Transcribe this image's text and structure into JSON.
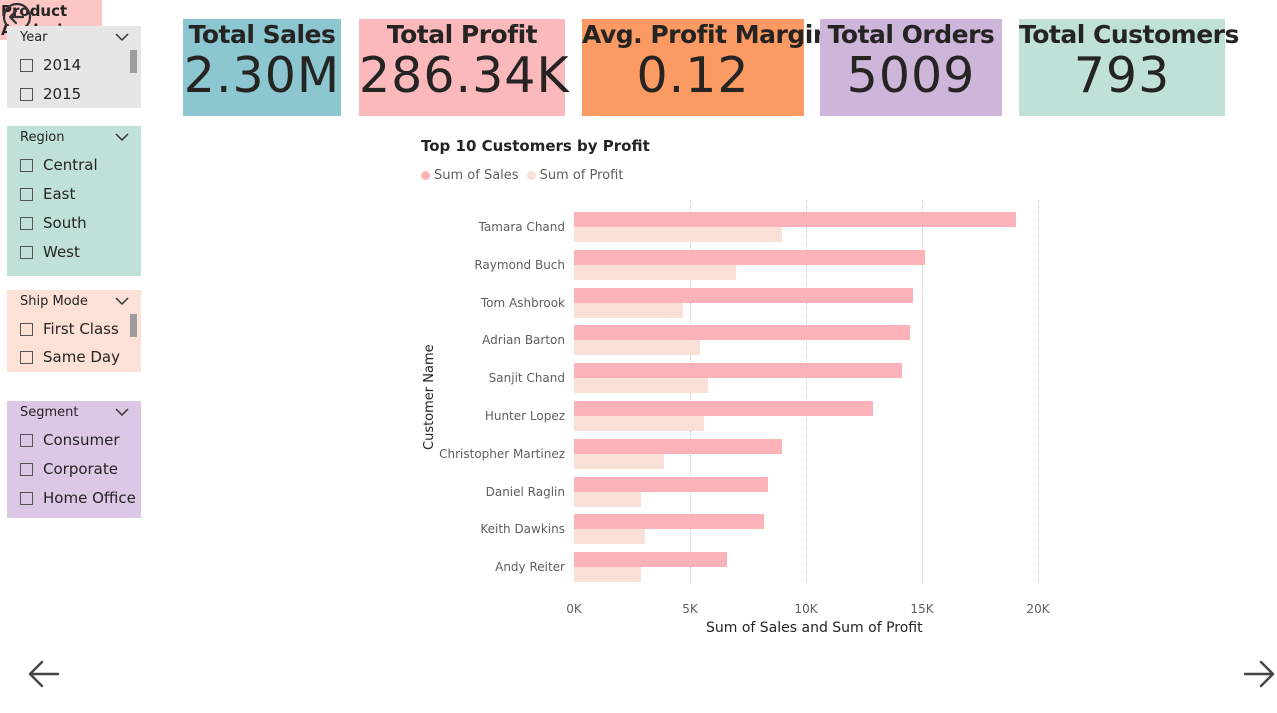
{
  "slicers": {
    "year": {
      "title": "Year",
      "items": [
        "2014",
        "2015"
      ],
      "bg": "#e6e6e6"
    },
    "region": {
      "title": "Region",
      "items": [
        "Central",
        "East",
        "South",
        "West"
      ],
      "bg": "#bfe1d8"
    },
    "shipmode": {
      "title": "Ship Mode",
      "items": [
        "First Class",
        "Same Day"
      ],
      "bg": "#fde0d6"
    },
    "segment": {
      "title": "Segment",
      "items": [
        "Consumer",
        "Corporate",
        "Home Office"
      ],
      "bg": "#dcc7e6"
    }
  },
  "kpis": [
    {
      "title": "Total Sales",
      "value": "2.30M",
      "color": "#8cc6d1"
    },
    {
      "title": "Total Profit",
      "value": "286.34K",
      "color": "#fbb9bc"
    },
    {
      "title": "Avg. Profit Margin",
      "value": "0.12",
      "color": "#fc9a63"
    },
    {
      "title": "Total Orders",
      "value": "5009",
      "color": "#cdb6da"
    },
    {
      "title": "Total Customers",
      "value": "793",
      "color": "#bfe1d8"
    }
  ],
  "chart_data": {
    "type": "bar",
    "orientation": "horizontal",
    "title": "Top 10 Customers by Profit",
    "xlabel": "Sum of Sales and Sum of Profit",
    "ylabel": "Customer Name",
    "legend_position": "top-left",
    "categories": [
      "Tamara Chand",
      "Raymond Buch",
      "Tom Ashbrook",
      "Adrian Barton",
      "Sanjit Chand",
      "Hunter Lopez",
      "Christopher Martinez",
      "Daniel Raglin",
      "Keith Dawkins",
      "Andy Reiter"
    ],
    "series": [
      {
        "name": "Sum of Sales",
        "color": "#fbb2b8",
        "values": [
          19052,
          15117,
          14596,
          14473,
          14142,
          12873,
          8954,
          8350,
          8181,
          6608
        ]
      },
      {
        "name": "Sum of Profit",
        "color": "#fae1d8",
        "values": [
          8981,
          6976,
          4703,
          5445,
          5757,
          5622,
          3900,
          2869,
          3039,
          2884
        ]
      }
    ],
    "xlim": [
      0,
      20000
    ],
    "xticks": [
      "0K",
      "5K",
      "10K",
      "15K",
      "20K"
    ],
    "grid": true
  },
  "nav": {
    "next_page_label_1": "Product",
    "next_page_label_2": "Analysis"
  }
}
